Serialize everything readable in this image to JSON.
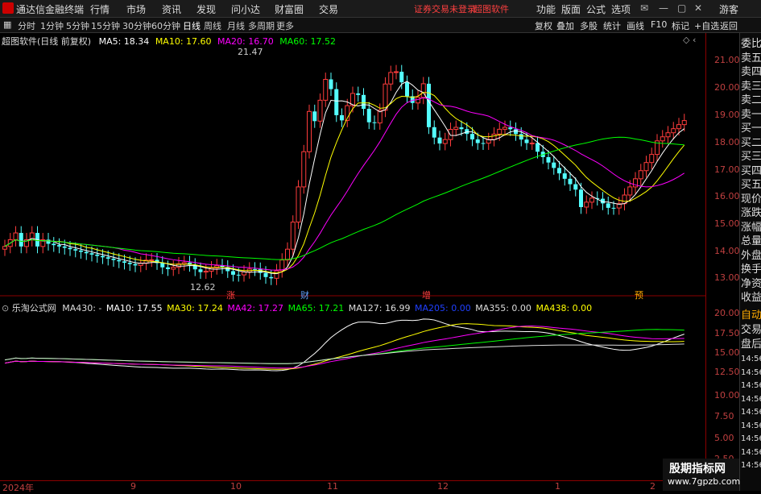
{
  "menubar": {
    "app_title": "通达信金融终端",
    "menus": [
      "行情",
      "市场",
      "资讯",
      "发现",
      "问小达",
      "财富圈",
      "交易"
    ],
    "warning": "证券交易未登录",
    "brand": "超图软件",
    "right_menus": [
      "功能",
      "版面",
      "公式",
      "选项"
    ],
    "guest": "游客"
  },
  "toolbar": {
    "periods": [
      "分时",
      "1分钟",
      "5分钟",
      "15分钟",
      "30分钟",
      "60分钟",
      "日线",
      "周线",
      "月线",
      "多周期",
      "更多"
    ],
    "active_period": "日线",
    "tools": [
      "复权",
      "叠加",
      "多股",
      "统计",
      "画线",
      "F10",
      "标记",
      "+自选",
      "返回"
    ]
  },
  "main_legend": {
    "title": "超图软件(日线 前复权)",
    "ma5": "MA5: 18.34",
    "ma10": "MA10: 17.60",
    "ma20": "MA20: 16.70",
    "ma60": "MA60: 17.52"
  },
  "indicator_legend": {
    "title": "乐淘公式网",
    "ma430": "MA430: -",
    "ma10": "MA10: 17.55",
    "ma30": "MA30: 17.24",
    "ma42": "MA42: 17.27",
    "ma65": "MA65: 17.21",
    "ma127": "MA127: 16.99",
    "ma205": "MA205: 0.00",
    "ma355": "MA355: 0.00",
    "ma438": "MA438: 0.00"
  },
  "price_axis": [
    "21.00",
    "20.00",
    "19.00",
    "18.00",
    "17.00",
    "16.00",
    "15.00",
    "14.00",
    "13.00"
  ],
  "ind_axis": [
    "20.00",
    "17.50",
    "15.00",
    "12.50",
    "10.00",
    "7.50",
    "5.00",
    "2.50"
  ],
  "time_axis": [
    "2024年",
    "9",
    "10",
    "11",
    "12",
    "1",
    "2"
  ],
  "annotations": {
    "high": "21.47",
    "low": "12.62"
  },
  "events": [
    "涨",
    "财",
    "增",
    "预"
  ],
  "right_panel": [
    "委比",
    "卖五",
    "卖四",
    "卖三",
    "卖二",
    "卖一",
    "买一",
    "买二",
    "买三",
    "买四",
    "买五",
    "现价",
    "涨跌",
    "涨幅",
    "总量",
    "外盘",
    "换手",
    "净资",
    "收益"
  ],
  "right_panel_lower": [
    "自动",
    "交易",
    "盘后",
    "14:56",
    "14:56",
    "14:56",
    "14:56",
    "14:56",
    "14:56",
    "14:56",
    "14:56",
    "14:56"
  ],
  "watermark": {
    "line1": "股期指标网",
    "line2": "www.7gpzb.com"
  },
  "colors": {
    "up": "#ff3c3c",
    "down": "#54ffff",
    "ma5": "#ffffff",
    "ma10": "#ffff00",
    "ma20": "#ff00ff",
    "ma60": "#00ff00"
  }
}
